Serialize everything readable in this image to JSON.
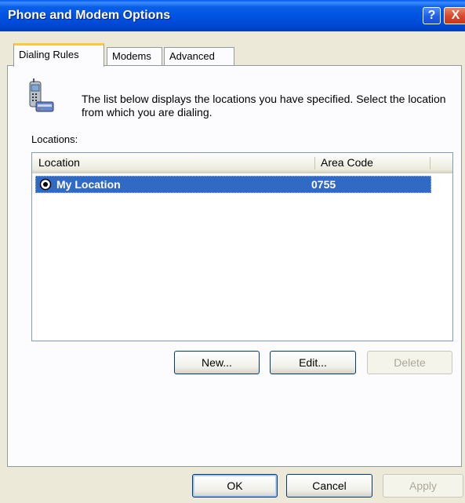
{
  "window": {
    "title": "Phone and Modem Options",
    "help_glyph": "?",
    "close_glyph": "X"
  },
  "tabs": [
    {
      "label": "Dialing Rules",
      "active": true
    },
    {
      "label": "Modems",
      "active": false
    },
    {
      "label": "Advanced",
      "active": false
    }
  ],
  "dialing_rules": {
    "description": "The list below displays the locations you have specified. Select the location from which you are dialing.",
    "locations_label": "Locations:",
    "columns": [
      "Location",
      "Area Code"
    ],
    "rows": [
      {
        "location": "My Location",
        "area_code": "0755",
        "selected": true
      }
    ],
    "buttons": {
      "new": "New...",
      "edit": "Edit...",
      "delete": "Delete"
    }
  },
  "dialog_buttons": {
    "ok": "OK",
    "cancel": "Cancel",
    "apply": "Apply"
  },
  "colors": {
    "titlebar": "#0054e3",
    "selection": "#316ac5",
    "tab_highlight": "#ffc83c"
  }
}
